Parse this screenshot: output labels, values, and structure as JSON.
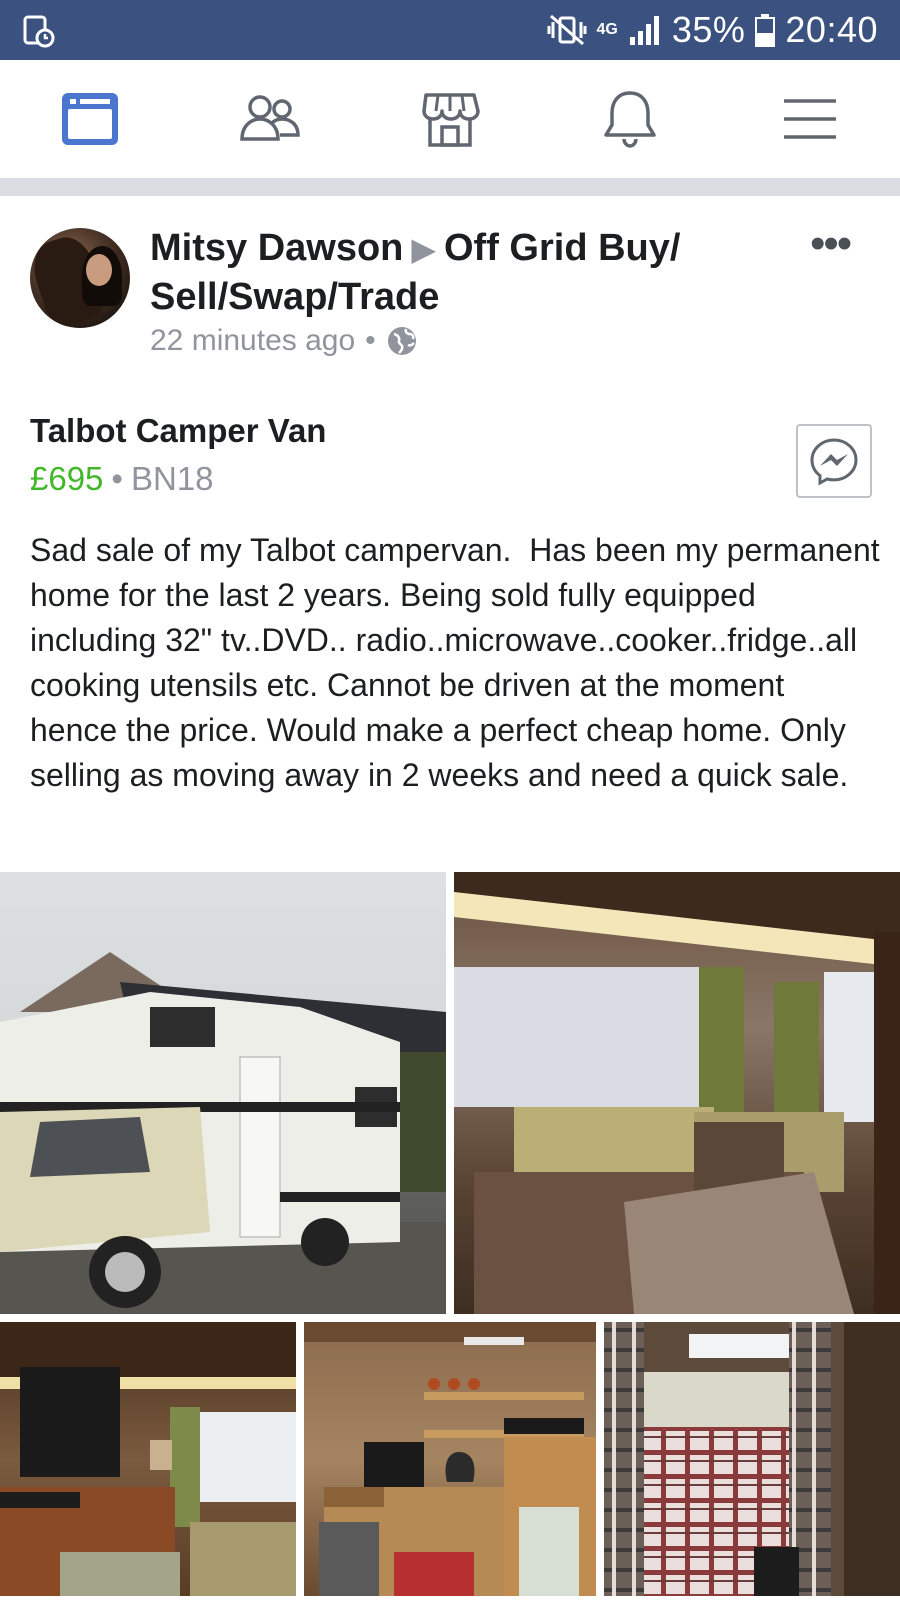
{
  "status_bar": {
    "battery": "35%",
    "time": "20:40",
    "network": "4G",
    "icons": [
      "screenshot-notification-icon",
      "vibrate-icon",
      "signal-icon",
      "battery-icon"
    ]
  },
  "nav": {
    "items": [
      {
        "name": "news-feed-icon",
        "active": true
      },
      {
        "name": "friends-icon",
        "active": false
      },
      {
        "name": "marketplace-icon",
        "active": false
      },
      {
        "name": "notifications-icon",
        "active": false
      },
      {
        "name": "menu-icon",
        "active": false
      }
    ],
    "active_color": "#4a76d0",
    "inactive_color": "#606770"
  },
  "post": {
    "author": "Mitsy Dawson",
    "group": "Off Grid Buy/ Sell/Swap/Trade",
    "time": "22 minutes ago",
    "privacy_icon": "globe-icon",
    "more_label": "•••",
    "item_title": "Talbot Camper Van",
    "price": "£695",
    "separator": "•",
    "location": "BN18",
    "message_icon": "messenger-icon",
    "description": "Sad sale of my Talbot campervan.  Has been my permanent home for the last 2 years. Being sold fully equipped including 32\" tv..DVD.. radio..microwave..cooker..fridge..all cooking utensils etc. Cannot be driven at the moment hence the price. Would make a perfect cheap home. Only selling as moving away in 2 weeks and need a quick sale.",
    "photos": [
      {
        "name": "photo-camper-exterior"
      },
      {
        "name": "photo-camper-seating"
      },
      {
        "name": "photo-camper-tv-area"
      },
      {
        "name": "photo-camper-kitchen"
      },
      {
        "name": "photo-camper-bed"
      }
    ]
  },
  "colors": {
    "status_bar": "#3b5281",
    "price": "#42b72a",
    "secondary_text": "#90949c"
  }
}
